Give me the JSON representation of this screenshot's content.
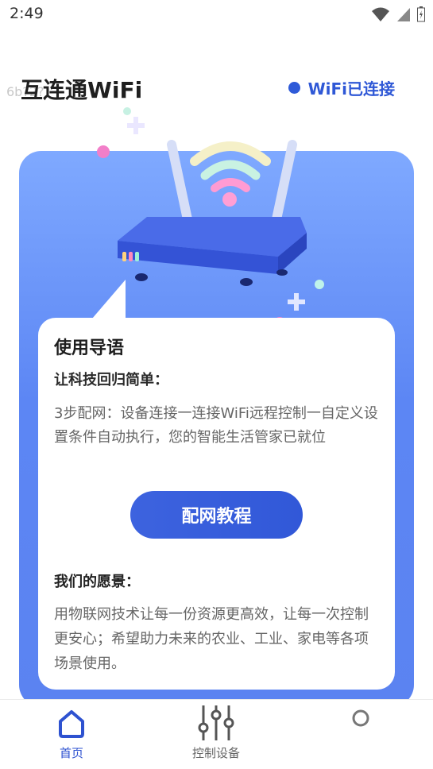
{
  "status_bar": {
    "time": "2:49"
  },
  "header": {
    "title": "互连通WiFi",
    "ghost_text": "6b?2?",
    "wifi_status": "WiFi已连接"
  },
  "guide": {
    "title": "使用导语",
    "subtitle": "让科技回归简单：",
    "body": "3步配网：设备连接一连接WiFi远程控制一自定义设置条件自动执行，您的智能生活管家已就位",
    "button_label": "配网教程"
  },
  "vision": {
    "title": "我们的愿景：",
    "body": "用物联网技术让每一份资源更高效，让每一次控制更安心；希望助力未来的农业、工业、家电等各项场景使用。"
  },
  "bottom_nav": {
    "items": [
      {
        "label": "首页",
        "icon": "home-icon",
        "active": true
      },
      {
        "label": "控制设备",
        "icon": "sliders-icon",
        "active": false
      },
      {
        "label": "",
        "icon": "profile-icon",
        "active": false
      }
    ]
  },
  "colors": {
    "accent": "#2f58d6",
    "card_gradient_top": "#7fa9ff",
    "card_gradient_bottom": "#5b83f1",
    "button": "#3158d8"
  }
}
